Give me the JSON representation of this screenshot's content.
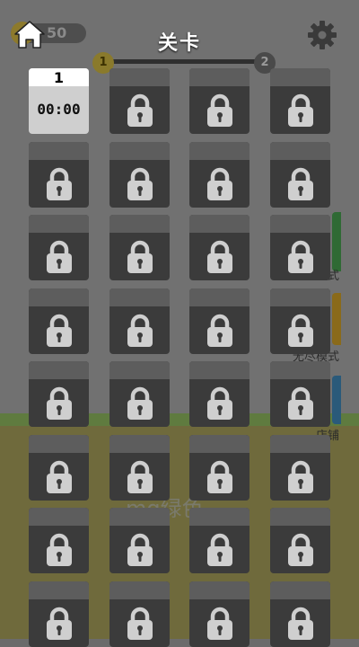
{
  "header": {
    "title": "关卡",
    "home_icon": "home-icon",
    "settings_icon": "gear-icon"
  },
  "background": {
    "coins": "50",
    "progress_start": "1",
    "progress_end": "2",
    "mode_labels": [
      "式",
      "无尽模式",
      "店铺"
    ],
    "watermark": "mg绿色"
  },
  "levels": [
    {
      "number": "1",
      "time": "00:00",
      "locked": false
    },
    {
      "locked": true
    },
    {
      "locked": true
    },
    {
      "locked": true
    },
    {
      "locked": true
    },
    {
      "locked": true
    },
    {
      "locked": true
    },
    {
      "locked": true
    },
    {
      "locked": true
    },
    {
      "locked": true
    },
    {
      "locked": true
    },
    {
      "locked": true
    },
    {
      "locked": true
    },
    {
      "locked": true
    },
    {
      "locked": true
    },
    {
      "locked": true
    },
    {
      "locked": true
    },
    {
      "locked": true
    },
    {
      "locked": true
    },
    {
      "locked": true
    },
    {
      "locked": true
    },
    {
      "locked": true
    },
    {
      "locked": true
    },
    {
      "locked": true
    },
    {
      "locked": true
    },
    {
      "locked": true
    },
    {
      "locked": true
    },
    {
      "locked": true
    },
    {
      "locked": true
    },
    {
      "locked": true
    },
    {
      "locked": true
    },
    {
      "locked": true
    }
  ],
  "colors": {
    "locked_tile": "#3b3b3b",
    "locked_cap": "#5d5d5d",
    "lock_icon": "#cfcfcf",
    "unlocked_tile": "#cfcfcf"
  }
}
